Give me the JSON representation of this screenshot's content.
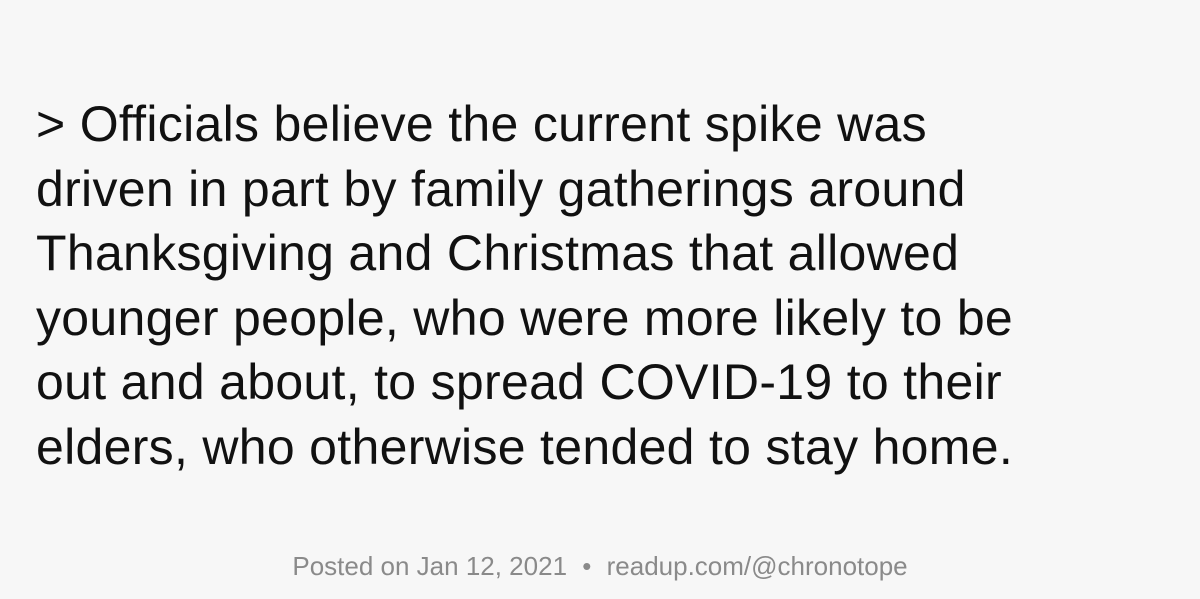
{
  "quote": {
    "lines": [
      "> Officials believe the current spike was",
      "driven in part by family gatherings around",
      "Thanksgiving and Christmas that allowed",
      "younger people, who were more likely to be",
      "out and about, to spread COVID-19 to their",
      "elders, who otherwise tended to stay home."
    ]
  },
  "footer": {
    "posted": "Posted on Jan 12, 2021",
    "separator": "•",
    "link": "readup.com/@chronotope"
  },
  "colors": {
    "background": "#f7f7f7",
    "text": "#111111",
    "footer_text": "#8a8a8a"
  }
}
